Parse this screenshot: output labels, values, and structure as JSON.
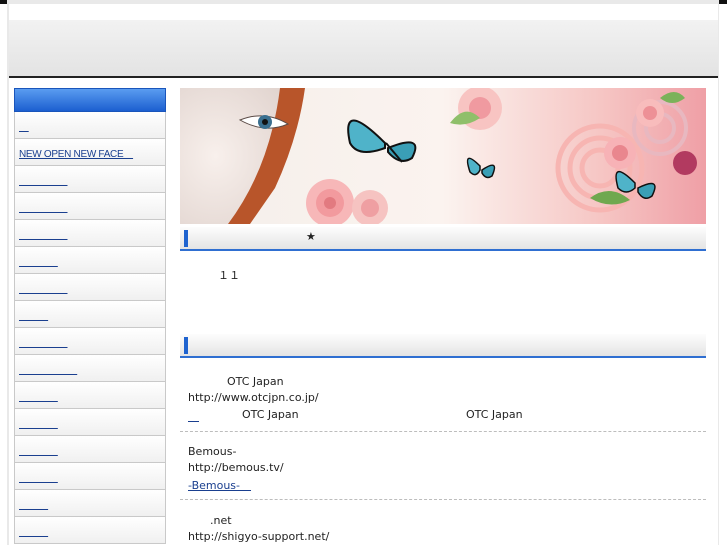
{
  "sidebar": {
    "items": [
      {
        "label": "　"
      },
      {
        "label": "NEW OPEN NEW FACE　"
      },
      {
        "label": "　　　　　"
      },
      {
        "label": "　　　　　"
      },
      {
        "label": "　　　　　"
      },
      {
        "label": "　　　　"
      },
      {
        "label": "　　　　　"
      },
      {
        "label": "　　　"
      },
      {
        "label": "　　　　　"
      },
      {
        "label": "　　　　　　"
      },
      {
        "label": "　　　　"
      },
      {
        "label": "　　　　"
      },
      {
        "label": "　　　　"
      },
      {
        "label": "　　　　"
      },
      {
        "label": "　　　"
      },
      {
        "label": "　　　"
      }
    ]
  },
  "section1": {
    "title": "★",
    "body": "１１"
  },
  "section2": {
    "title": "",
    "entries": [
      {
        "line1": "OTC Japan",
        "url": "http://www.otcjpn.co.jp/",
        "link": "　",
        "note1": "OTC Japan",
        "note2": "OTC Japan"
      },
      {
        "line1": "Bemous-",
        "url": "http://bemous.tv/",
        "link": "-Bemous-　"
      },
      {
        "line1": ".net",
        "url": "http://shigyo-support.net/"
      }
    ]
  },
  "colors": {
    "accent": "#1f63cf",
    "link": "#1a3f8f",
    "sidebar_head": "#2a6ee0"
  },
  "banner": {
    "icons": [
      "butterfly-icon",
      "rose-icon"
    ]
  }
}
